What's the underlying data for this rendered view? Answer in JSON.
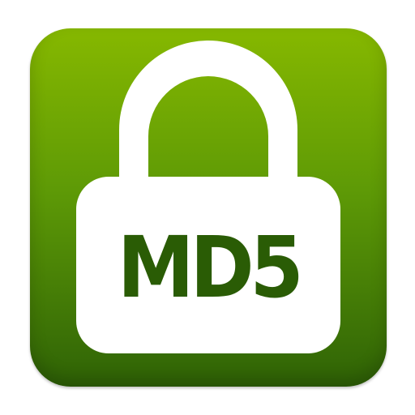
{
  "icon": {
    "label": "MD5",
    "colors": {
      "gradient_top": "#86b800",
      "gradient_bottom": "#2f6306",
      "lock_fill": "#ffffff",
      "label_color": "#2a5c05"
    },
    "glyph": "padlock-icon"
  }
}
